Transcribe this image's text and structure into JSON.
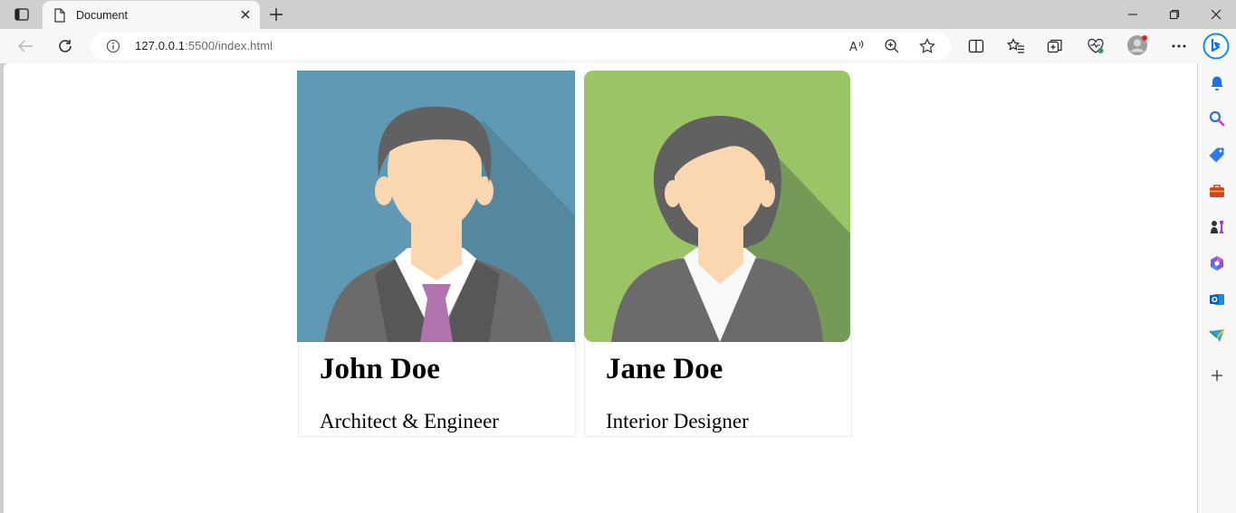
{
  "browser": {
    "tab": {
      "title": "Document",
      "icon": "document-icon"
    },
    "address_bar": {
      "host": "127.0.0.1",
      "rest": ":5500/index.html"
    }
  },
  "cards": [
    {
      "name": "John Doe",
      "role": "Architect & Engineer",
      "photo_bg": "#5f99b4",
      "tie": "#b173ad"
    },
    {
      "name": "Jane Doe",
      "role": "Interior Designer",
      "photo_bg": "#9ac466"
    }
  ]
}
